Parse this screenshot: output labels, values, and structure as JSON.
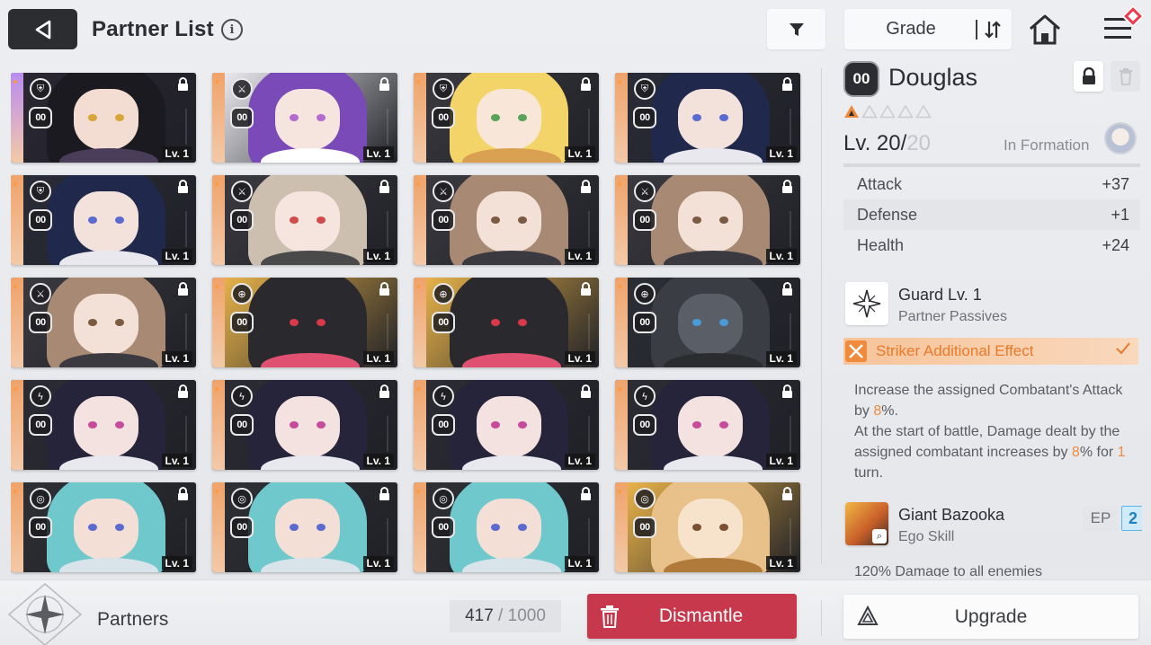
{
  "header": {
    "title": "Partner List",
    "info_glyph": "i",
    "sort_label": "Grade",
    "icons": [
      "back-icon",
      "info-icon",
      "filter-icon",
      "sort-order-icon",
      "home-icon",
      "menu-icon",
      "notification-badge-icon"
    ]
  },
  "cards": [
    {
      "class_icon": "shield",
      "grade": "00",
      "level": "Lv. 1",
      "stripe": "#b98cf0",
      "bg": "#2a2733",
      "hair": "#1b1a20",
      "skin": "#f3dcd2",
      "eye": "#d8a53a",
      "cloth": "#4a3d5a"
    },
    {
      "class_icon": "sword",
      "grade": "00",
      "level": "Lv. 1",
      "stripe": "#f0a36a",
      "bg": "#e9e9ee",
      "hair": "#7a4ab8",
      "skin": "#f6e4de",
      "eye": "#b46ad0",
      "cloth": "#ffffff"
    },
    {
      "class_icon": "shield",
      "grade": "00",
      "level": "Lv. 1",
      "stripe": "#f0a36a",
      "bg": "#3a3a40",
      "hair": "#f2d468",
      "skin": "#f8e6d8",
      "eye": "#5aa35a",
      "cloth": "#d8a050"
    },
    {
      "class_icon": "shield",
      "grade": "00",
      "level": "Lv. 1",
      "stripe": "#f0a36a",
      "bg": "#2a2c38",
      "hair": "#20294c",
      "skin": "#f3e2dc",
      "eye": "#5a6ad0",
      "cloth": "#e8e8ee"
    },
    {
      "class_icon": "shield",
      "grade": "00",
      "level": "Lv. 1",
      "stripe": "#f0a36a",
      "bg": "#2a2c38",
      "hair": "#20294c",
      "skin": "#f3e2dc",
      "eye": "#5a6ad0",
      "cloth": "#e8e8ee"
    },
    {
      "class_icon": "sword",
      "grade": "00",
      "level": "Lv. 1",
      "stripe": "#f0a36a",
      "bg": "#3a3a40",
      "hair": "#cdbfb0",
      "skin": "#f6e4de",
      "eye": "#d04a4a",
      "cloth": "#4a4a4a"
    },
    {
      "class_icon": "sword",
      "grade": "00",
      "level": "Lv. 1",
      "stripe": "#f0a36a",
      "bg": "#3a3a40",
      "hair": "#a88a74",
      "skin": "#f3e0d6",
      "eye": "#7a5a40",
      "cloth": "#3a3a40"
    },
    {
      "class_icon": "sword",
      "grade": "00",
      "level": "Lv. 1",
      "stripe": "#f0a36a",
      "bg": "#3a3a40",
      "hair": "#a88a74",
      "skin": "#f3e0d6",
      "eye": "#7a5a40",
      "cloth": "#3a3a40"
    },
    {
      "class_icon": "sword",
      "grade": "00",
      "level": "Lv. 1",
      "stripe": "#f0a36a",
      "bg": "#3a3a40",
      "hair": "#a88a74",
      "skin": "#f3e0d6",
      "eye": "#7a5a40",
      "cloth": "#3a3a40"
    },
    {
      "class_icon": "target",
      "grade": "00",
      "level": "Lv. 1",
      "stripe": "#f0a36a",
      "bg": "#e6b24a",
      "hair": "#2a2a2e",
      "skin": "#2a2a2e",
      "eye": "#d83a4a",
      "cloth": "#e05070"
    },
    {
      "class_icon": "target",
      "grade": "00",
      "level": "Lv. 1",
      "stripe": "#f0a36a",
      "bg": "#e6b24a",
      "hair": "#2a2a2e",
      "skin": "#2a2a2e",
      "eye": "#d83a4a",
      "cloth": "#e05070"
    },
    {
      "class_icon": "target",
      "grade": "00",
      "level": "Lv. 1",
      "stripe": "#f0a36a",
      "bg": "#2c2f36",
      "hair": "#3a3d44",
      "skin": "#5a5e66",
      "eye": "#4a9ad8",
      "cloth": "#2a2c30"
    },
    {
      "class_icon": "lightning",
      "grade": "00",
      "level": "Lv. 1",
      "stripe": "#f0a36a",
      "bg": "#2c2c34",
      "hair": "#25243a",
      "skin": "#f4e2e0",
      "eye": "#c84a9a",
      "cloth": "#e8e8ee"
    },
    {
      "class_icon": "lightning",
      "grade": "00",
      "level": "Lv. 1",
      "stripe": "#f0a36a",
      "bg": "#2c2c34",
      "hair": "#25243a",
      "skin": "#f4e2e0",
      "eye": "#c84a9a",
      "cloth": "#e8e8ee"
    },
    {
      "class_icon": "lightning",
      "grade": "00",
      "level": "Lv. 1",
      "stripe": "#f0a36a",
      "bg": "#2c2c34",
      "hair": "#25243a",
      "skin": "#f4e2e0",
      "eye": "#c84a9a",
      "cloth": "#e8e8ee"
    },
    {
      "class_icon": "lightning",
      "grade": "00",
      "level": "Lv. 1",
      "stripe": "#f0a36a",
      "bg": "#2c2c34",
      "hair": "#25243a",
      "skin": "#f4e2e0",
      "eye": "#c84a9a",
      "cloth": "#e8e8ee"
    },
    {
      "class_icon": "circle",
      "grade": "00",
      "level": "Lv. 1",
      "stripe": "#f0a36a",
      "bg": "#2e3036",
      "hair": "#6ec8cc",
      "skin": "#f3dfd6",
      "eye": "#5a6ad0",
      "cloth": "#d8e4ea"
    },
    {
      "class_icon": "circle",
      "grade": "00",
      "level": "Lv. 1",
      "stripe": "#f0a36a",
      "bg": "#2e3036",
      "hair": "#6ec8cc",
      "skin": "#f3dfd6",
      "eye": "#5a6ad0",
      "cloth": "#d8e4ea"
    },
    {
      "class_icon": "circle",
      "grade": "00",
      "level": "Lv. 1",
      "stripe": "#f0a36a",
      "bg": "#2e3036",
      "hair": "#6ec8cc",
      "skin": "#f3dfd6",
      "eye": "#5a6ad0",
      "cloth": "#d8e4ea"
    },
    {
      "class_icon": "circle",
      "grade": "00",
      "level": "Lv. 1",
      "stripe": "#f0a36a",
      "bg": "#e8b24a",
      "hair": "#e8c08a",
      "skin": "#f7e2cc",
      "eye": "#7a5030",
      "cloth": "#b07a3a"
    }
  ],
  "detail": {
    "grade": "00",
    "name": "Douglas",
    "stars_filled": 1,
    "stars_total": 5,
    "level_prefix": "Lv. 20/",
    "level_max": "20",
    "in_formation": "In Formation",
    "stats": [
      {
        "label": "Attack",
        "value": "+37"
      },
      {
        "label": "Defense",
        "value": "+1"
      },
      {
        "label": "Health",
        "value": "+24"
      }
    ],
    "passive": {
      "name": "Guard Lv. 1",
      "sub": "Partner Passives"
    },
    "effect": {
      "label": "Striker Additional Effect"
    },
    "effect_desc": {
      "p1": "Increase the assigned Combatant's Attack by ",
      "v1": "8",
      "p2": "%.",
      "p3": "At the start of battle, Damage dealt by the assigned combatant increases by ",
      "v2": "8",
      "p4": "% for ",
      "v3": "1",
      "p5": " turn."
    },
    "ego": {
      "name": "Giant Bazooka",
      "sub": "Ego Skill",
      "ep_label": "EP",
      "ep_value": "2"
    },
    "cut_text": "120% Damage to all enemies"
  },
  "footer": {
    "label": "Partners",
    "count_current": "417",
    "count_sep": " / ",
    "count_max": "1000",
    "dismantle_label": "Dismantle",
    "upgrade_label": "Upgrade"
  },
  "colors": {
    "accent_orange": "#ef8a3c",
    "dismantle_red": "#c8384c",
    "ep_blue": "#5bb5e8"
  }
}
